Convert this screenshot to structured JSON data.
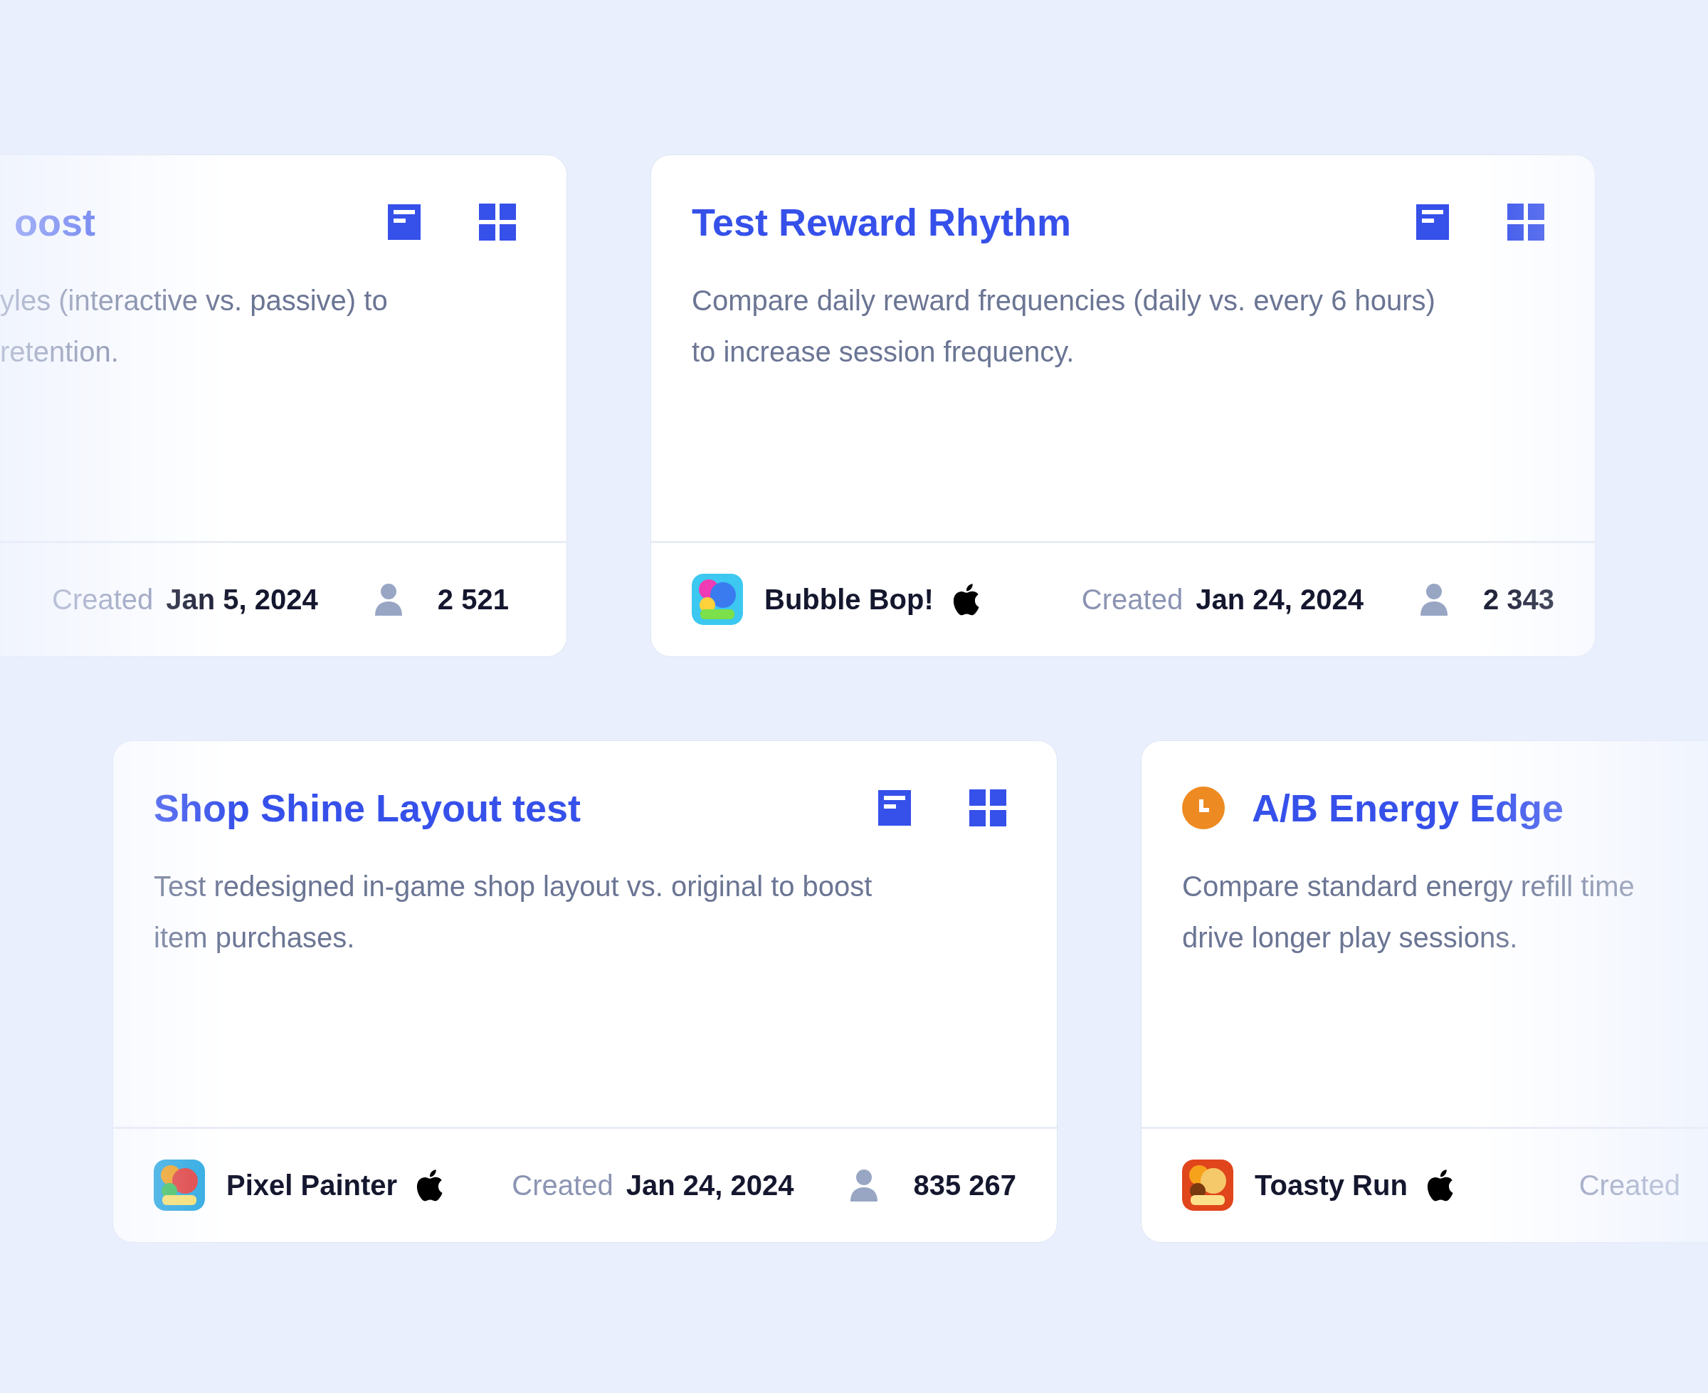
{
  "rows": [
    {
      "cards": [
        {
          "title": "oost",
          "actions_visible": true,
          "description_lines": [
            "yles (interactive vs. passive) to",
            "retention."
          ],
          "created_label": "Created",
          "created_date": "Jan 5, 2024",
          "users": "2 521"
        },
        {
          "title": "Test Reward Rhythm",
          "actions_visible": true,
          "description_lines": [
            "Compare daily reward frequencies (daily vs. every 6 hours)",
            "to increase session frequency."
          ],
          "app": {
            "name": "Bubble Bop!",
            "kind": "bubble"
          },
          "created_label": "Created",
          "created_date": "Jan 24, 2024",
          "users": "2 343"
        }
      ]
    },
    {
      "cards": [
        {
          "title": "Shop Shine Layout test",
          "actions_visible": true,
          "description_lines": [
            "Test redesigned in-game shop layout vs. original to boost",
            "item purchases."
          ],
          "app": {
            "name": "Pixel Painter",
            "kind": "painter"
          },
          "created_label": "Created",
          "created_date": "Jan 24, 2024",
          "users": "835 267"
        },
        {
          "title": "A/B Energy Edge",
          "kind": "scheduled",
          "description_lines": [
            "Compare standard energy refill time",
            "drive longer play sessions."
          ],
          "app": {
            "name": "Toasty Run",
            "kind": "toast"
          },
          "created_label": "Created"
        }
      ]
    }
  ]
}
